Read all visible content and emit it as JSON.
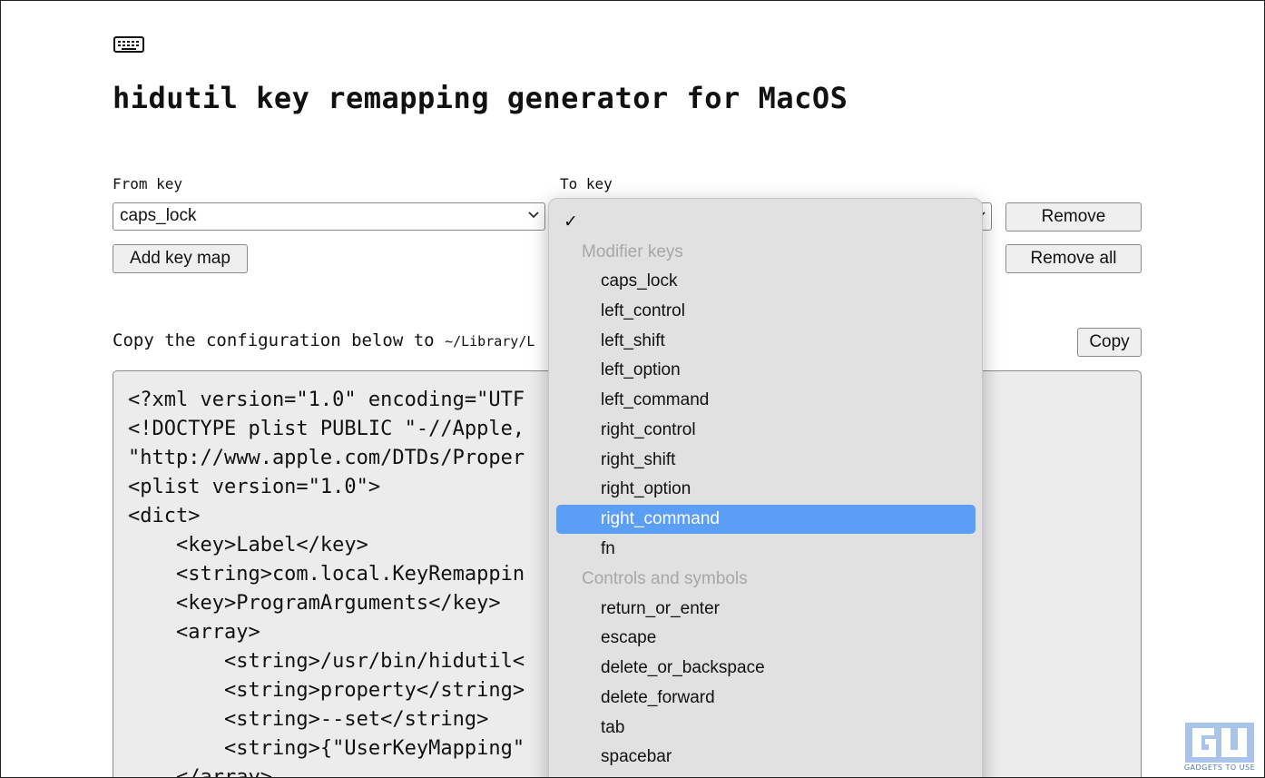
{
  "app": {
    "title": "hidutil key remapping generator for MacOS",
    "icon": "keyboard-icon"
  },
  "form": {
    "from_label": "From key",
    "to_label": "To key",
    "from_value": "caps_lock",
    "remove_label": "Remove",
    "add_label": "Add key map",
    "remove_all_label": "Remove all"
  },
  "config": {
    "instruction": "Copy the configuration below to",
    "path": "~/Library/L",
    "copy_label": "Copy",
    "lines": [
      "<?xml version=\"1.0\" encoding=\"UTF",
      "<!DOCTYPE plist PUBLIC \"-//Apple,",
      "\"http://www.apple.com/DTDs/Proper",
      "<plist version=\"1.0\">",
      "<dict>",
      "    <key>Label</key>",
      "    <string>com.local.KeyRemappin",
      "    <key>ProgramArguments</key>",
      "    <array>",
      "        <string>/usr/bin/hidutil<",
      "        <string>property</string>",
      "        <string>--set</string>",
      "        <string>{\"UserKeyMapping\"",
      "    </array>"
    ]
  },
  "dropdown": {
    "check_mark": "✓",
    "group_modifier": "Modifier keys",
    "group_controls": "Controls and symbols",
    "modifier_items": [
      "caps_lock",
      "left_control",
      "left_shift",
      "left_option",
      "left_command",
      "right_control",
      "right_shift",
      "right_option",
      "right_command",
      "fn"
    ],
    "control_items": [
      "return_or_enter",
      "escape",
      "delete_or_backspace",
      "delete_forward",
      "tab",
      "spacebar"
    ],
    "selected": "right_command",
    "highlight_color": "#5b9ef5"
  },
  "watermark": {
    "text": "GADGETS TO USE",
    "color": "#4a78b5"
  }
}
